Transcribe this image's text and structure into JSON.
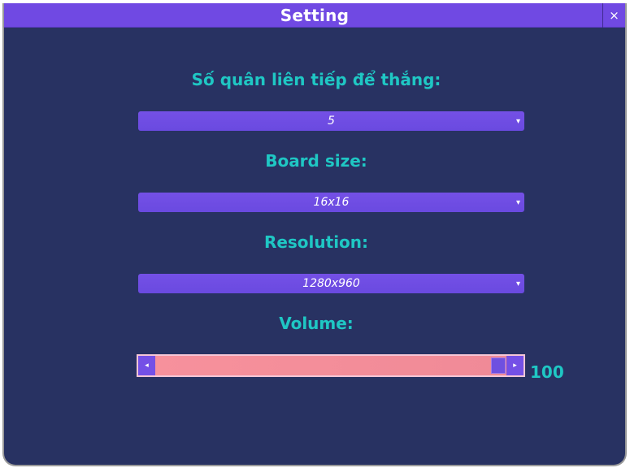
{
  "window": {
    "title": "Setting",
    "close_label": "×"
  },
  "settings": {
    "win_count": {
      "label": "Số quân liên tiếp để thắng:",
      "value": "5"
    },
    "board_size": {
      "label": "Board size:",
      "value": "16x16"
    },
    "resolution": {
      "label": "Resolution:",
      "value": "1280x960"
    },
    "volume": {
      "label": "Volume:",
      "value": "100",
      "level_percent": 100
    }
  },
  "icons": {
    "dropdown_arrow": "▾",
    "slider_left": "◂",
    "slider_right": "▸"
  },
  "colors": {
    "background": "#283262",
    "accent_purple": "#7049e3",
    "label_cyan": "#1fc7c4",
    "slider_pink": "#f28d9a"
  }
}
